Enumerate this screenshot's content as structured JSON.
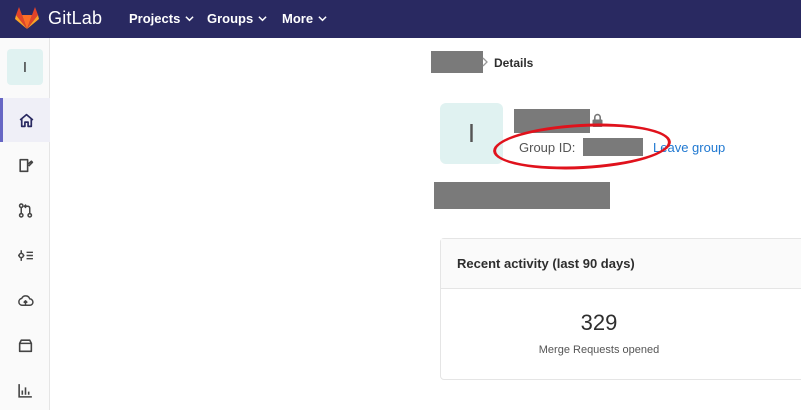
{
  "navbar": {
    "brand": "GitLab",
    "items": [
      {
        "label": "Projects"
      },
      {
        "label": "Groups"
      },
      {
        "label": "More"
      }
    ]
  },
  "sidebar": {
    "context_initial": "I",
    "items": [
      {
        "icon": "home-icon",
        "active": true
      },
      {
        "icon": "issues-icon"
      },
      {
        "icon": "merge-request-icon"
      },
      {
        "icon": "kubernetes-icon"
      },
      {
        "icon": "cloud-icon"
      },
      {
        "icon": "package-icon"
      },
      {
        "icon": "analytics-icon"
      }
    ]
  },
  "breadcrumb": {
    "current": "Details"
  },
  "group": {
    "initial": "I",
    "id_label": "Group ID:",
    "leave_label": "Leave group"
  },
  "activity": {
    "title": "Recent activity (last 90 days)",
    "metric_value": "329",
    "metric_label": "Merge Requests opened"
  },
  "colors": {
    "navbar": "#292961",
    "link": "#1f78d1",
    "annotation": "#e0121c",
    "avatar_bg": "#e0f2f1"
  }
}
